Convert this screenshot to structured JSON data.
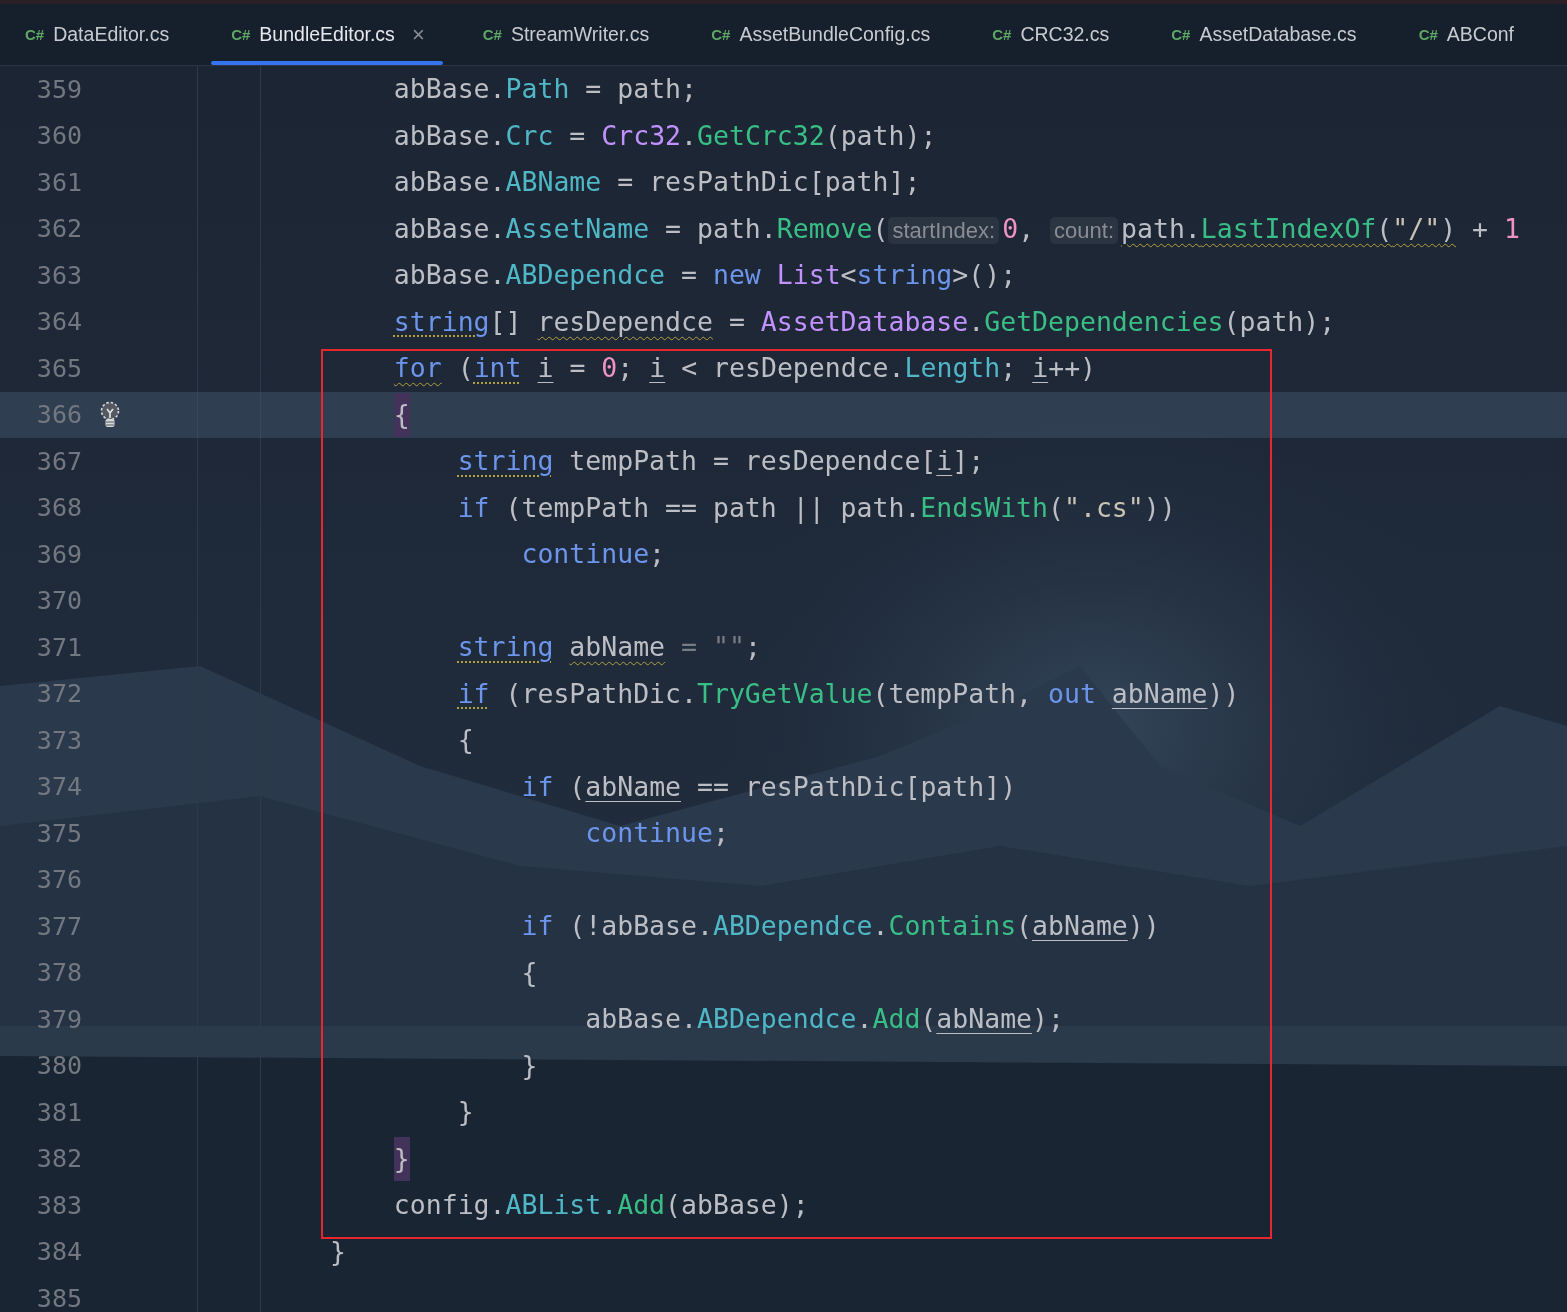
{
  "tabs": [
    {
      "icon": "C#",
      "label": "DataEditor.cs",
      "selected": false,
      "closable": false
    },
    {
      "icon": "C#",
      "label": "BundleEditor.cs",
      "selected": true,
      "closable": true,
      "close": "×"
    },
    {
      "icon": "C#",
      "label": "StreamWriter.cs",
      "selected": false,
      "closable": false
    },
    {
      "icon": "C#",
      "label": "AssetBundleConfig.cs",
      "selected": false,
      "closable": false
    },
    {
      "icon": "C#",
      "label": "CRC32.cs",
      "selected": false,
      "closable": false
    },
    {
      "icon": "C#",
      "label": "AssetDatabase.cs",
      "selected": false,
      "closable": false
    },
    {
      "icon": "C#",
      "label": "ABConf",
      "selected": false,
      "closable": false
    }
  ],
  "editor": {
    "lines": [
      {
        "number": "359",
        "current": false,
        "bulb": false,
        "tokens": [
          {
            "kind": "plain",
            "text": "    abBase."
          },
          {
            "kind": "field",
            "text": "Path"
          },
          {
            "kind": "plain",
            "text": " = path;"
          }
        ]
      },
      {
        "number": "360",
        "current": false,
        "bulb": false,
        "tokens": [
          {
            "kind": "plain",
            "text": "    abBase."
          },
          {
            "kind": "field",
            "text": "Crc"
          },
          {
            "kind": "plain",
            "text": " = "
          },
          {
            "kind": "type",
            "text": "Crc32"
          },
          {
            "kind": "plain",
            "text": "."
          },
          {
            "kind": "method",
            "text": "GetCrc32"
          },
          {
            "kind": "plain",
            "text": "(path);"
          }
        ]
      },
      {
        "number": "361",
        "current": false,
        "bulb": false,
        "tokens": [
          {
            "kind": "plain",
            "text": "    abBase."
          },
          {
            "kind": "field",
            "text": "ABName"
          },
          {
            "kind": "plain",
            "text": " = resPathDic[path];"
          }
        ]
      },
      {
        "number": "362",
        "current": false,
        "bulb": false,
        "tokens": [
          {
            "kind": "plain",
            "text": "    abBase."
          },
          {
            "kind": "field",
            "text": "AssetName"
          },
          {
            "kind": "plain",
            "text": " = path."
          },
          {
            "kind": "method",
            "text": "Remove"
          },
          {
            "kind": "plain",
            "text": "("
          },
          {
            "kind": "hint",
            "text": "startIndex:"
          },
          {
            "kind": "number",
            "text": "0"
          },
          {
            "kind": "plain",
            "text": ", "
          },
          {
            "kind": "hint",
            "text": "count:"
          },
          {
            "kind": "plain",
            "text": "path.",
            "wavy_underline": true
          },
          {
            "kind": "method",
            "text": "LastIndexOf",
            "wavy_underline": true
          },
          {
            "kind": "plain",
            "text": "(",
            "wavy_underline": true
          },
          {
            "kind": "string",
            "text": "\"/\"",
            "wavy_underline": true
          },
          {
            "kind": "plain",
            "text": ")",
            "wavy_underline": true
          },
          {
            "kind": "plain",
            "text": " + "
          },
          {
            "kind": "number",
            "text": "1"
          }
        ]
      },
      {
        "number": "363",
        "current": false,
        "bulb": false,
        "tokens": [
          {
            "kind": "plain",
            "text": "    abBase."
          },
          {
            "kind": "field",
            "text": "ABDependce"
          },
          {
            "kind": "plain",
            "text": " = "
          },
          {
            "kind": "keyword",
            "text": "new "
          },
          {
            "kind": "type",
            "text": "List"
          },
          {
            "kind": "plain",
            "text": "<"
          },
          {
            "kind": "keyword",
            "text": "string"
          },
          {
            "kind": "plain",
            "text": ">();"
          }
        ]
      },
      {
        "number": "364",
        "current": false,
        "bulb": false,
        "tokens": [
          {
            "kind": "keyword",
            "text": "    string",
            "dotted_underline": true
          },
          {
            "kind": "plain",
            "text": "[] "
          },
          {
            "kind": "plain",
            "text": "resDependce",
            "wavy_underline": true
          },
          {
            "kind": "plain",
            "text": " = "
          },
          {
            "kind": "type",
            "text": "AssetDatabase"
          },
          {
            "kind": "plain",
            "text": "."
          },
          {
            "kind": "method",
            "text": "GetDependencies"
          },
          {
            "kind": "plain",
            "text": "(path);"
          }
        ]
      },
      {
        "number": "365",
        "current": false,
        "bulb": false,
        "tokens": [
          {
            "kind": "keyword",
            "text": "    for",
            "wavy_underline": true
          },
          {
            "kind": "plain",
            "text": " ("
          },
          {
            "kind": "keyword",
            "text": "int",
            "dotted_underline": true
          },
          {
            "kind": "plain",
            "text": " i",
            "underlined": true
          },
          {
            "kind": "plain",
            "text": " = "
          },
          {
            "kind": "number",
            "text": "0"
          },
          {
            "kind": "plain",
            "text": "; "
          },
          {
            "kind": "plain",
            "text": "i",
            "underlined": true
          },
          {
            "kind": "plain",
            "text": " < resDependce."
          },
          {
            "kind": "field",
            "text": "Length"
          },
          {
            "kind": "plain",
            "text": "; "
          },
          {
            "kind": "plain",
            "text": "i",
            "underlined": true
          },
          {
            "kind": "plain",
            "text": "++)"
          }
        ]
      },
      {
        "number": "366",
        "current": true,
        "bulb": true,
        "tokens": [
          {
            "kind": "match",
            "text": "    {"
          }
        ]
      },
      {
        "number": "367",
        "current": false,
        "bulb": false,
        "tokens": [
          {
            "kind": "keyword",
            "text": "        string",
            "dotted_underline": true
          },
          {
            "kind": "plain",
            "text": " tempPath = resDependce["
          },
          {
            "kind": "plain",
            "text": "i",
            "underlined": true
          },
          {
            "kind": "plain",
            "text": "];"
          }
        ]
      },
      {
        "number": "368",
        "current": false,
        "bulb": false,
        "tokens": [
          {
            "kind": "keyword",
            "text": "        if"
          },
          {
            "kind": "plain",
            "text": " (tempPath == path || path."
          },
          {
            "kind": "method",
            "text": "EndsWith"
          },
          {
            "kind": "plain",
            "text": "("
          },
          {
            "kind": "string",
            "text": "\".cs\""
          },
          {
            "kind": "plain",
            "text": "))"
          }
        ]
      },
      {
        "number": "369",
        "current": false,
        "bulb": false,
        "tokens": [
          {
            "kind": "keyword",
            "text": "            continue"
          },
          {
            "kind": "plain",
            "text": ";"
          }
        ]
      },
      {
        "number": "370",
        "current": false,
        "bulb": false
      },
      {
        "number": "371",
        "current": false,
        "bulb": false,
        "tokens": [
          {
            "kind": "keyword",
            "text": "        string",
            "dotted_underline": true
          },
          {
            "kind": "plain",
            "text": " abName",
            "wavy_underline": true
          },
          {
            "kind": "dim",
            "text": " = \"\""
          },
          {
            "kind": "plain",
            "text": ";"
          }
        ]
      },
      {
        "number": "372",
        "current": false,
        "bulb": false,
        "tokens": [
          {
            "kind": "keyword",
            "text": "        if",
            "dotted_underline": true
          },
          {
            "kind": "plain",
            "text": " (resPathDic."
          },
          {
            "kind": "method",
            "text": "TryGetValue"
          },
          {
            "kind": "plain",
            "text": "(tempPath, "
          },
          {
            "kind": "keyword",
            "text": "out"
          },
          {
            "kind": "plain",
            "text": " abName",
            "underlined": true
          },
          {
            "kind": "plain",
            "text": "))"
          }
        ]
      },
      {
        "number": "373",
        "current": false,
        "bulb": false,
        "tokens": [
          {
            "kind": "plain",
            "text": "        {"
          }
        ]
      },
      {
        "number": "374",
        "current": false,
        "bulb": false,
        "tokens": [
          {
            "kind": "keyword",
            "text": "            if"
          },
          {
            "kind": "plain",
            "text": " ("
          },
          {
            "kind": "plain",
            "text": "abName",
            "underlined": true
          },
          {
            "kind": "plain",
            "text": " == resPathDic[path])"
          }
        ]
      },
      {
        "number": "375",
        "current": false,
        "bulb": false,
        "tokens": [
          {
            "kind": "keyword",
            "text": "                continue"
          },
          {
            "kind": "plain",
            "text": ";"
          }
        ]
      },
      {
        "number": "376",
        "current": false,
        "bulb": false
      },
      {
        "number": "377",
        "current": false,
        "bulb": false,
        "tokens": [
          {
            "kind": "keyword",
            "text": "            if"
          },
          {
            "kind": "plain",
            "text": " (!abBase."
          },
          {
            "kind": "field",
            "text": "ABDependce"
          },
          {
            "kind": "plain",
            "text": "."
          },
          {
            "kind": "method",
            "text": "Contains"
          },
          {
            "kind": "plain",
            "text": "("
          },
          {
            "kind": "plain",
            "text": "abName",
            "underlined": true
          },
          {
            "kind": "plain",
            "text": "))"
          }
        ]
      },
      {
        "number": "378",
        "current": false,
        "bulb": false,
        "tokens": [
          {
            "kind": "plain",
            "text": "            {"
          }
        ]
      },
      {
        "number": "379",
        "current": false,
        "bulb": false,
        "tokens": [
          {
            "kind": "plain",
            "text": "                abBase."
          },
          {
            "kind": "field",
            "text": "ABDependce"
          },
          {
            "kind": "plain",
            "text": "."
          },
          {
            "kind": "method",
            "text": "Add"
          },
          {
            "kind": "plain",
            "text": "("
          },
          {
            "kind": "plain",
            "text": "abName",
            "underlined": true
          },
          {
            "kind": "plain",
            "text": ");"
          }
        ]
      },
      {
        "number": "380",
        "current": false,
        "bulb": false,
        "tokens": [
          {
            "kind": "plain",
            "text": "            }"
          }
        ]
      },
      {
        "number": "381",
        "current": false,
        "bulb": false,
        "tokens": [
          {
            "kind": "plain",
            "text": "        }"
          }
        ]
      },
      {
        "number": "382",
        "current": false,
        "bulb": false,
        "tokens": [
          {
            "kind": "match",
            "text": "    }"
          }
        ]
      },
      {
        "number": "383",
        "current": false,
        "bulb": false,
        "tokens": [
          {
            "kind": "plain",
            "text": "    config."
          },
          {
            "kind": "field",
            "text": "ABList."
          },
          {
            "kind": "method",
            "text": "Add"
          },
          {
            "kind": "plain",
            "text": "(abBase);"
          }
        ]
      },
      {
        "number": "384",
        "current": false,
        "bulb": false,
        "tokens": [
          {
            "kind": "plain",
            "text": "}"
          }
        ]
      },
      {
        "number": "385",
        "current": false,
        "bulb": false
      }
    ]
  },
  "annotation": {
    "shown": true
  }
}
